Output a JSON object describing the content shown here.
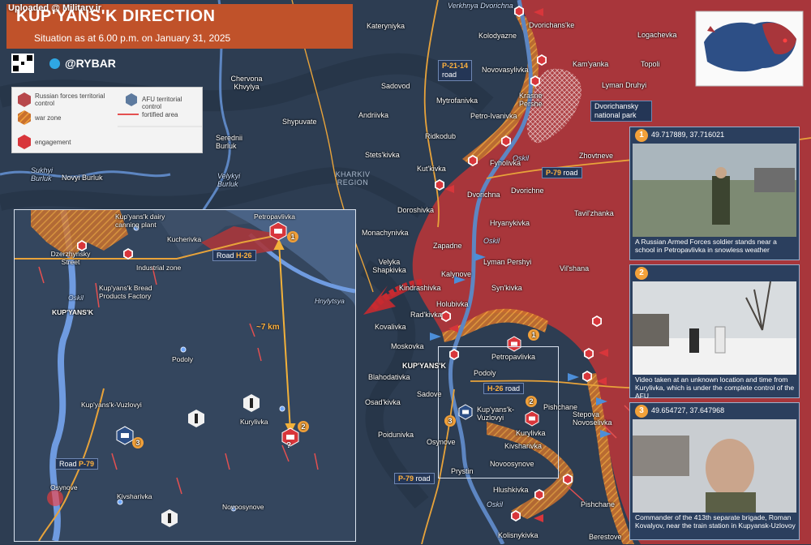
{
  "watermark": "Uploaded @ Military.ir",
  "header": {
    "title": "KUP'YANS'K DIRECTION",
    "subtitle": "Situation as at 6.00 p.m. on January 31, 2025",
    "brand": "@RYBAR"
  },
  "colors": {
    "russian_control": "#a8363b",
    "war_zone": "#e0943a",
    "afu_control": "#2b3b4f",
    "fortified_area": "#e45050",
    "engagement": "#d8363b",
    "accent": "#c0522a",
    "river": "#5d86c2"
  },
  "legend": {
    "russian": "Russian forces territorial control",
    "afu": "AFU territorial control",
    "war_zone": "war zone",
    "fortified": "fortified area",
    "engagement": "engagement"
  },
  "map": {
    "region": "KHARKIV REGION",
    "rivers": {
      "verkhnya_dvorichna": "Verkhnya Dvorichna",
      "sukhyi_burluk": "Sukhyi Burluk",
      "velykyi_burluk": "Velykyi Burluk",
      "oskil_1": "Oskil",
      "oskil_2": "Oskil",
      "oskil_3": "Oskil"
    },
    "places": {
      "kateryniyka": "Kateryniyka",
      "dvorichanske": "Dvorichans'ke",
      "logachevka": "Logachevka",
      "kolodyazne": "Kolodyazne",
      "kamyanka": "Kam'yanka",
      "topoli": "Topoli",
      "novovasylivka": "Novovasylivka",
      "lyman_druhyi": "Lyman Druhyi",
      "chervona_khvylya": "Chervona Khvylya",
      "sadovod": "Sadovod",
      "mytrofanivka": "Mytrofanivka",
      "krasne_pershe": "Krasne Pershe",
      "dvorichansky_np": "Dvorichansky national park",
      "shypuvate": "Shypuvate",
      "andriivka": "Andriivka",
      "petro_ivanivka": "Petro-Ivanivka",
      "seredni_burluk": "Serednii Burluk",
      "ridkodub": "Ridkodub",
      "zhovtneve": "Zhovtneve",
      "stets_kivka": "Stets'kivka",
      "fyholivka": "Fyholivka",
      "velykyi_burluk": "Velykyi Burluk",
      "novyi_burluk": "Novyi Burluk",
      "kutkivka": "Kut'kivka",
      "dvorichna": "Dvorichna",
      "dvorichne": "Dvorichne",
      "tavilzhanka": "Tavil'zhanka",
      "doroshivka": "Doroshivka",
      "hryanykivka": "Hryanykivka",
      "monachynivka": "Monachynivka",
      "zapadne": "Zapadne",
      "lyman_pershyi": "Lyman Pershyi",
      "velyka_shapkivka": "Velyka Shapkivka",
      "vilshana": "Vil'shana",
      "kalynove": "Kalynove",
      "kindrashivka": "Kindrashivka",
      "synkivka": "Syn'kivka",
      "holubivka": "Holubivka",
      "radkivka": "Rad'kivka",
      "kovalivka": "Kovalivka",
      "moskovka": "Moskovka",
      "petropavlivka": "Petropavlivka",
      "kupyansk": "KUP'YANS'K",
      "blahodativka": "Blahodativka",
      "podoly": "Podoly",
      "sadove": "Sadove",
      "osadkivka": "Osad'kivka",
      "pishchane": "Pishchane",
      "kupyansk_vuzlovyi": "Kup'yans'k-Vuzlovyi",
      "stepova_novoselivka": "Stepova Novoselivka",
      "poidunivka": "Poidunivka",
      "osynove": "Osynove",
      "kurylivka": "Kurylivka",
      "kivsharivka": "Kivsharivka",
      "novoosynove": "Novoosynove",
      "prystin": "Prystin",
      "hlushkivka": "Hlushkivka",
      "kolisnykivka": "Kolisnykivka",
      "berestove": "Berestove"
    },
    "roads": {
      "p21_num": "P-21-14",
      "p21_word": "road",
      "p79_num": "P-79",
      "p79_word": "road",
      "p79b_num": "P-79",
      "p79b_word": "road",
      "h26_num": "H-26",
      "h26_word": "road"
    }
  },
  "inset": {
    "places": {
      "petropavlivka": "Petropavlivka",
      "dairy": "Kup'yans'k dairy canning plant",
      "kucherivka": "Kucherivka",
      "dzerzhynsky": "Dzerzhynsky Street",
      "industrial": "Industrial zone",
      "bread": "Kup'yans'k Bread Products Factory",
      "kupyansk": "KUP'YANS'K",
      "podoly": "Podoly",
      "vuzlovyi": "Kup'yans'k-Vuzlovyi",
      "kurylivka": "Kurylivka",
      "osynove": "Osynove",
      "kivsharivka": "Kivsharivka",
      "novoosynove": "Novoosynove",
      "oskil": "Oskil",
      "hnylytsya": "Hnylytsya"
    },
    "road_h26": {
      "word": "Road",
      "num": "H-26"
    },
    "road_p79": {
      "word": "Road",
      "num": "P-79"
    },
    "distance": "~7 km",
    "unknown_mark": "?"
  },
  "photos": [
    {
      "num": "1",
      "coord": "49.717889, 37.716021",
      "caption": "A Russian Armed Forces soldier stands near a school in Petropavlivka in snowless weather"
    },
    {
      "num": "2",
      "coord": "",
      "caption": "Video taken at an unknown location and time from Kurylivka, which is under the complete control of the AFU"
    },
    {
      "num": "3",
      "coord": "49.654727, 37.647968",
      "caption": "Commander of the 413th separate brigade, Roman Kovalyov, near the train station in Kupyansk-Uzlovoy"
    }
  ],
  "markers": {
    "n1": "1",
    "n2": "2",
    "n3": "3",
    "i1": "1",
    "i2": "2",
    "i3": "3"
  }
}
